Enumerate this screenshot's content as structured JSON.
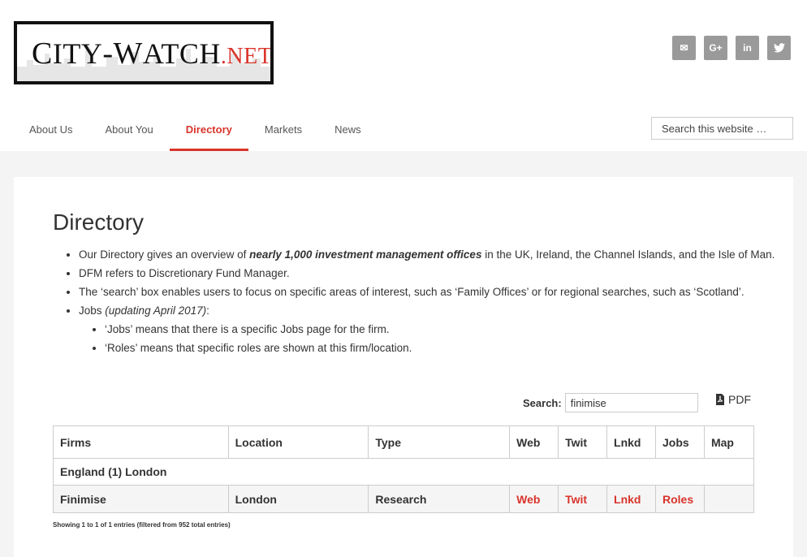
{
  "logo": {
    "part1": "C",
    "part2": "ITY",
    "part3": "-W",
    "part4": "ATCH",
    "net": ".NET"
  },
  "social": [
    {
      "icon": "mail-icon",
      "glyph": "✉"
    },
    {
      "icon": "google-plus-icon",
      "glyph": "G+"
    },
    {
      "icon": "linkedin-icon",
      "glyph": "in"
    },
    {
      "icon": "twitter-icon",
      "glyph": "🐦"
    }
  ],
  "nav": [
    "About Us",
    "About You",
    "Directory",
    "Markets",
    "News"
  ],
  "site_search": {
    "placeholder": "Search this website …"
  },
  "page": {
    "title": "Directory",
    "b1_pre": "Our Directory gives an overview of ",
    "b1_bold": "nearly 1,000 investment management offices",
    "b1_post": " in the UK, Ireland, the Channel Islands, and the Isle of Man.",
    "b2": "DFM refers to Discretionary Fund Manager.",
    "b3": "The ‘search’ box enables users to focus on specific areas of interest, such as ‘Family Offices’ or for regional searches, such as ‘Scotland’.",
    "b4_pre": "Jobs ",
    "b4_italic": "(updating April 2017)",
    "b4_post": ":",
    "b4_sub1": "‘Jobs’ means that there is a specific Jobs page for the firm.",
    "b4_sub2": "‘Roles’ means that specific roles are shown at this firm/location."
  },
  "table_search": {
    "label": "Search:",
    "value": "finimise"
  },
  "pdf": {
    "label": "PDF"
  },
  "table": {
    "headers": [
      "Firms",
      "Location",
      "Type",
      "Web",
      "Twit",
      "Lnkd",
      "Jobs",
      "Map"
    ],
    "group": "England (1) London",
    "row": {
      "firm": "Finimise",
      "location": "London",
      "type": "Research",
      "web": "Web",
      "twit": "Twit",
      "lnkd": "Lnkd",
      "jobs": "Roles",
      "map": ""
    }
  },
  "info": "Showing 1 to 1 of 1 entries (filtered from 952 total entries)"
}
